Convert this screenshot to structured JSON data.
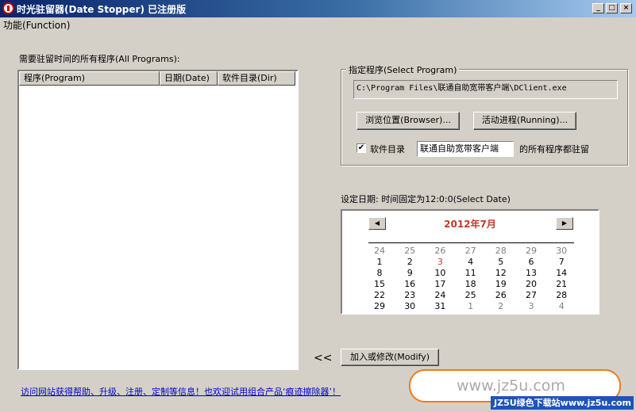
{
  "window": {
    "title": "时光驻留器(Date Stopper) 已注册版",
    "min_glyph": "_",
    "max_glyph": "□",
    "close_glyph": "×"
  },
  "menu": {
    "function_label": "功能(Function)"
  },
  "programs": {
    "label": "需要驻留时间的所有程序(All Programs):",
    "columns": [
      "程序(Program)",
      "日期(Date)",
      "软件目录(Dir)"
    ]
  },
  "select_program": {
    "title": "指定程序(Select Program)",
    "path": "C:\\Program Files\\联通自助宽带客户端\\DClient.exe",
    "browse_label": "浏览位置(Browser)...",
    "running_label": "活动进程(Running)...",
    "checkbox_label": "软件目录",
    "checkbox_checked": true,
    "check_glyph": "✔",
    "dir_value": "联通自助宽带客户端",
    "suffix": "的所有程序都驻留"
  },
  "date": {
    "label": "设定日期: 时间固定为12:0:0(Select Date)",
    "month_title": "2012年7月",
    "prev_glyph": "◀",
    "next_glyph": "▶",
    "weeks": [
      [
        {
          "d": "24",
          "o": true
        },
        {
          "d": "25",
          "o": true
        },
        {
          "d": "26",
          "o": true
        },
        {
          "d": "27",
          "o": true
        },
        {
          "d": "28",
          "o": true
        },
        {
          "d": "29",
          "o": true
        },
        {
          "d": "30",
          "o": true
        }
      ],
      [
        {
          "d": "1"
        },
        {
          "d": "2"
        },
        {
          "d": "3",
          "t": true
        },
        {
          "d": "4"
        },
        {
          "d": "5"
        },
        {
          "d": "6"
        },
        {
          "d": "7"
        }
      ],
      [
        {
          "d": "8"
        },
        {
          "d": "9"
        },
        {
          "d": "10"
        },
        {
          "d": "11"
        },
        {
          "d": "12"
        },
        {
          "d": "13"
        },
        {
          "d": "14"
        }
      ],
      [
        {
          "d": "15"
        },
        {
          "d": "16"
        },
        {
          "d": "17"
        },
        {
          "d": "18"
        },
        {
          "d": "19"
        },
        {
          "d": "20"
        },
        {
          "d": "21"
        }
      ],
      [
        {
          "d": "22"
        },
        {
          "d": "23"
        },
        {
          "d": "24"
        },
        {
          "d": "25"
        },
        {
          "d": "26"
        },
        {
          "d": "27"
        },
        {
          "d": "28"
        }
      ],
      [
        {
          "d": "29"
        },
        {
          "d": "30"
        },
        {
          "d": "31"
        },
        {
          "d": "1",
          "o": true
        },
        {
          "d": "2",
          "o": true
        },
        {
          "d": "3",
          "o": true
        },
        {
          "d": "4",
          "o": true
        }
      ]
    ]
  },
  "actions": {
    "arrows": "<<",
    "modify_label": "加入或修改(Modify)"
  },
  "footer": {
    "link_text": "访问网站获得帮助、升级、注册、定制等信息！也欢迎试用组合产品‘痕迹擦除器’！"
  },
  "watermark": {
    "url": "www.jz5u.com",
    "banner": "JZ5U绿色下载站www.jz5u.com"
  }
}
